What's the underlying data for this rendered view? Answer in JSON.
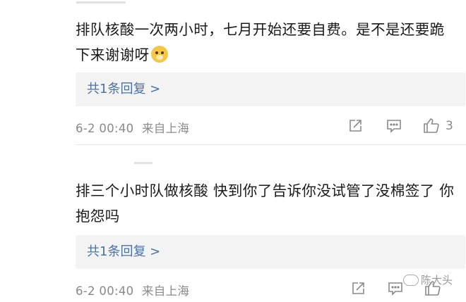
{
  "comments": [
    {
      "text": "排队核酸一次两小时，七月开始还要自费。是不是还要跪下来谢谢呀",
      "emoji_icon": "doge-emoji",
      "reply_link": "共1条回复 >",
      "date": "6-2 00:40",
      "location": "来自上海",
      "likes": "3"
    },
    {
      "text": "排三个小时队做核酸 快到你了告诉你没试管了没棉签了 你抱怨吗",
      "reply_link": "共1条回复 >",
      "date": "6-2 00:40",
      "location": "来自上海",
      "likes": ""
    }
  ],
  "watermark": {
    "icon": "wechat-icon",
    "text": "陈大头"
  }
}
